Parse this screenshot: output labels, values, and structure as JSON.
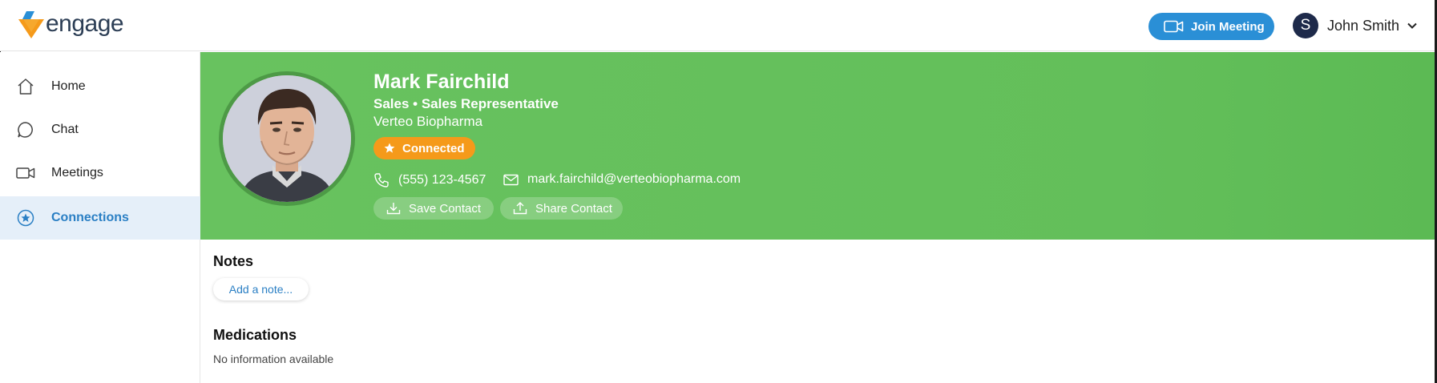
{
  "app": {
    "name": "engage"
  },
  "header": {
    "join_label": "Join Meeting",
    "user": {
      "initial": "S",
      "name": "John Smith"
    }
  },
  "sidebar": {
    "items": [
      {
        "label": "Home",
        "icon": "home-icon",
        "active": false
      },
      {
        "label": "Chat",
        "icon": "chat-icon",
        "active": false
      },
      {
        "label": "Meetings",
        "icon": "video-icon",
        "active": false
      },
      {
        "label": "Connections",
        "icon": "star-circle-icon",
        "active": true
      }
    ]
  },
  "profile": {
    "name": "Mark Fairchild",
    "role": "Sales • Sales Representative",
    "company": "Verteo Biopharma",
    "status": "Connected",
    "phone": "(555) 123-4567",
    "email": "mark.fairchild@verteobiopharma.com",
    "save_label": "Save Contact",
    "share_label": "Share Contact"
  },
  "notes": {
    "title": "Notes",
    "add_label": "Add a note..."
  },
  "medications": {
    "title": "Medications",
    "empty_text": "No information available"
  },
  "colors": {
    "brand_blue": "#2a8fd6",
    "hero_green": "#66c15d",
    "badge_orange": "#f59a1a",
    "active_bg": "#e5eff9"
  }
}
